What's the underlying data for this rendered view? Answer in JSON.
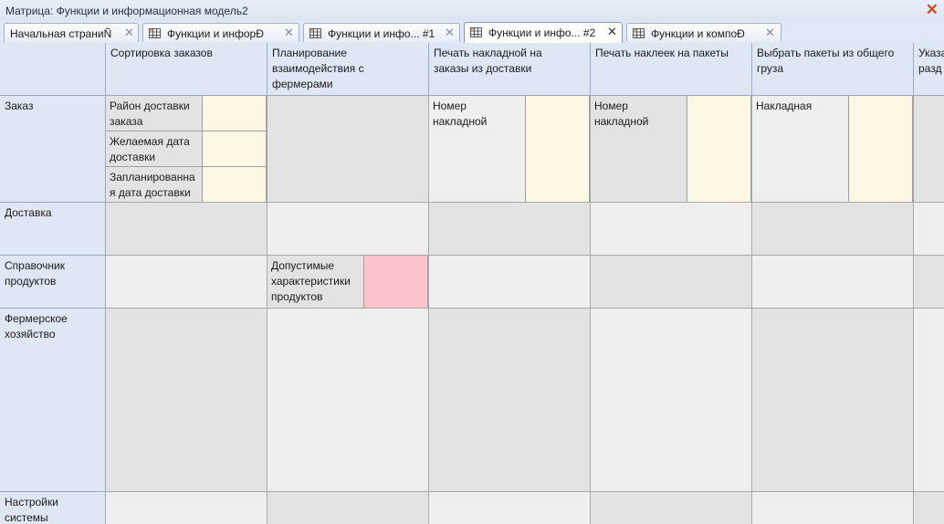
{
  "window": {
    "title": "Матрица: Функции и информационная модель2"
  },
  "tabs": [
    {
      "label": "Начальная страниÑ",
      "active": false
    },
    {
      "label": "Функции и инфорÐ",
      "active": false
    },
    {
      "label": "Функции и инфо... #1",
      "active": false
    },
    {
      "label": "Функции и инфо... #2",
      "active": true
    },
    {
      "label": "Функции и компоÐ",
      "active": false
    }
  ],
  "columns": [
    "Сортировка заказов",
    "Планирование взаимодействия с фермерами",
    "Печать накладной на заказы из доставки",
    "Печать наклеек на пакеты",
    "Выбрать пакеты из общего груза",
    "Указа разд"
  ],
  "rows": [
    "Заказ",
    "Доставка",
    "Справочник продуктов",
    "Фермерское хозяйство",
    "Настройки системы"
  ],
  "items": {
    "order_sort": [
      "Район доставки заказа",
      "Желаемая дата доставки",
      "Запланированная дата доставки"
    ],
    "order_print_invoice": "Номер накладной",
    "order_print_labels": "Номер накладной",
    "order_pick_packages": "Накладная",
    "products_planning": "Допустимые характеристики продуктов"
  },
  "colors": {
    "header_bg": "#dfe7f4",
    "cell_dark": "#e3e3e3",
    "cell_light": "#efefef",
    "attr_yellow": "#fdf7e6",
    "attr_pink": "#fbc4cb"
  }
}
